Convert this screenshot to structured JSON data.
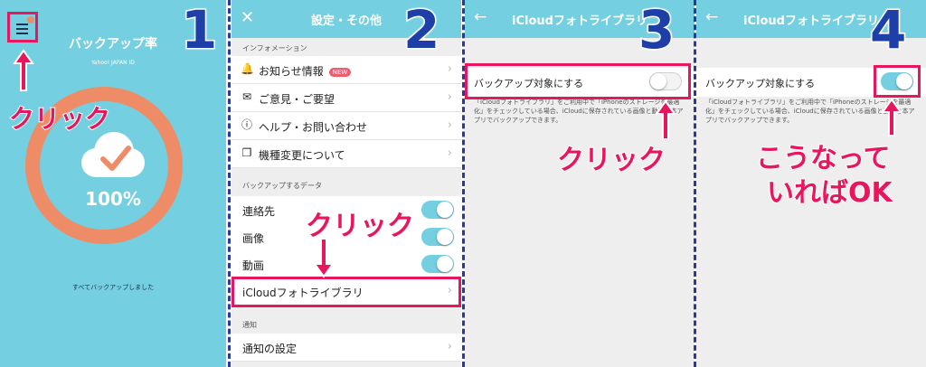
{
  "panel1": {
    "title": "バックアップ率",
    "subtitle": "Yahoo! JAPAN ID",
    "percent": "100%",
    "footer": "すべてバックアップしました",
    "menu_icon": "hamburger-menu-icon",
    "colors": {
      "bg": "#74cfe0",
      "ring": "#ef8c68"
    }
  },
  "panel2": {
    "title": "設定・その他",
    "close_icon": "close-icon",
    "section_info": "インフォメーション",
    "info_items": [
      {
        "label": "お知らせ情報",
        "icon": "bell-icon",
        "badge": "NEW"
      },
      {
        "label": "ご意見・ご要望",
        "icon": "mail-icon"
      },
      {
        "label": "ヘルプ・お問い合わせ",
        "icon": "info-icon"
      },
      {
        "label": "機種変更について",
        "icon": "copy-icon"
      }
    ],
    "section_backup": "バックアップするデータ",
    "backup_items": [
      {
        "label": "連絡先",
        "state": "on"
      },
      {
        "label": "画像",
        "state": "on"
      },
      {
        "label": "動画",
        "state": "on"
      }
    ],
    "icloud_row": "iCloudフォトライブラリ",
    "section_notify": "通知",
    "notify_row": "通知の設定"
  },
  "panel3": {
    "title": "iCloudフォトライブラリ",
    "toggle_label": "バックアップ対象にする",
    "toggle_state": "off",
    "description": "「iCloudフォトライブラリ」をご利用中で「iPhoneのストレージを最適化」をチェックしている場合、iCloudに保存されている画像と動画を本アプリでバックアップできます。"
  },
  "panel4": {
    "title": "iCloudフォトライブラリ",
    "toggle_label": "バックアップ対象にする",
    "toggle_state": "on",
    "description": "「iCloudフォトライブラリ」をご利用中で「iPhoneのストレージを最適化」をチェックしている場合、iCloudに保存されている画像と動画を本アプリでバックアップできます。"
  },
  "annotations": {
    "step1": "1",
    "step2": "2",
    "step3": "3",
    "step4": "4",
    "click1": "クリック",
    "click2": "クリック",
    "click3": "クリック",
    "result_line1": "こうなって",
    "result_line2": "いればOK",
    "accent": "#e8175d",
    "step_color": "#1f3fa8"
  }
}
